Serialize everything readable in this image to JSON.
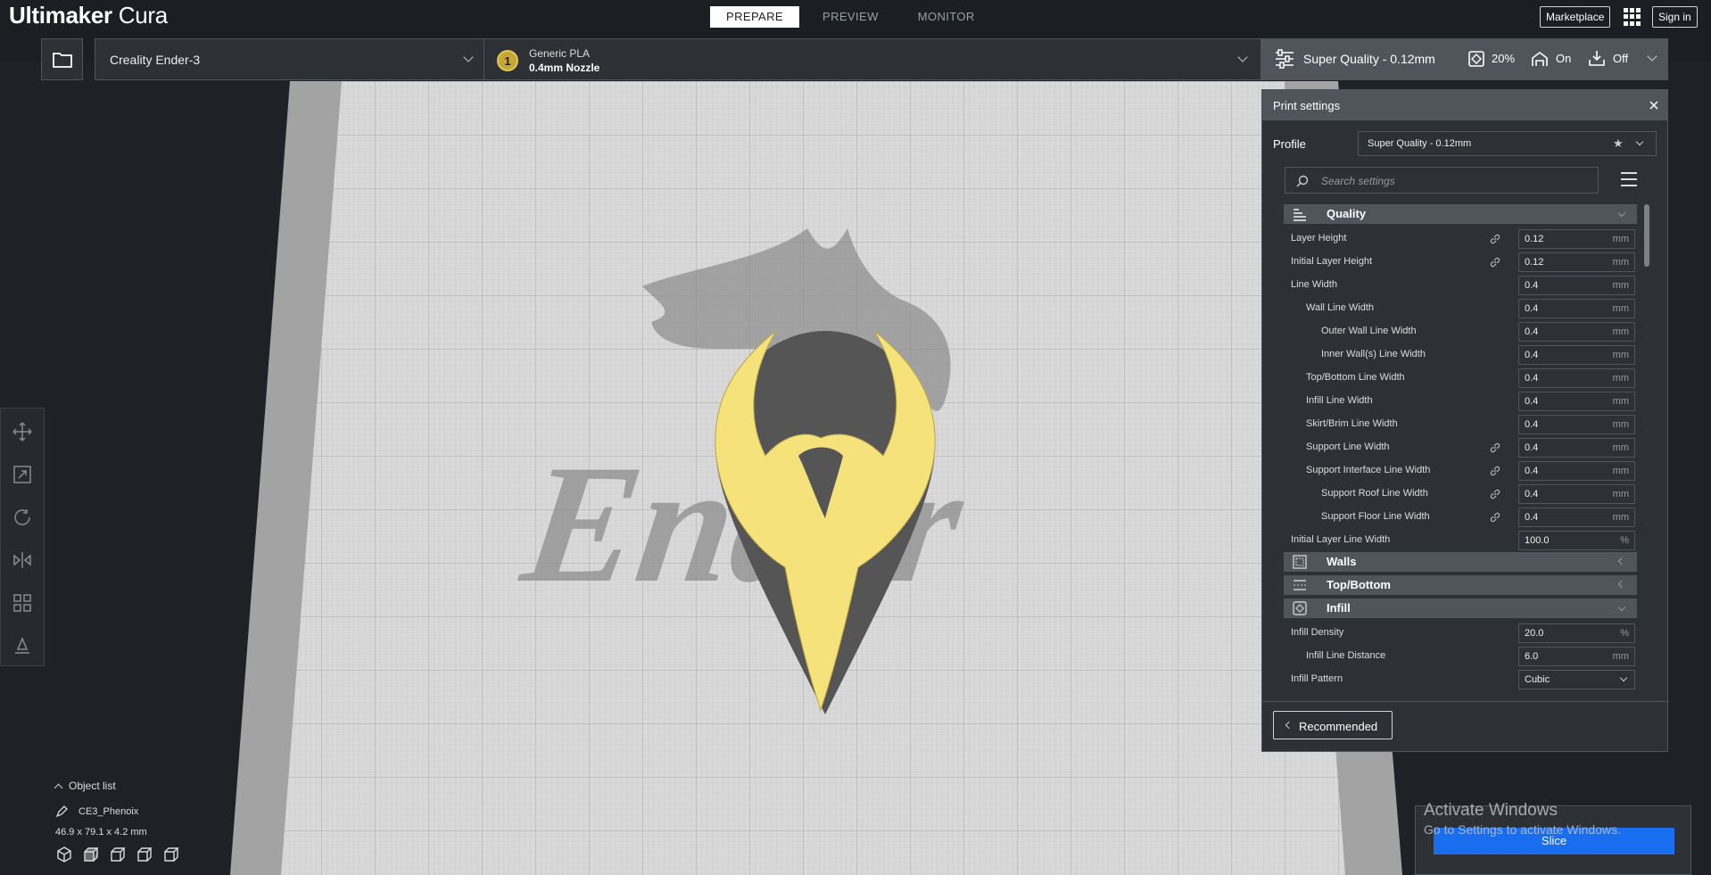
{
  "app": {
    "title_bold": "Ultimaker",
    "title_light": " Cura"
  },
  "stages": [
    "PREPARE",
    "PREVIEW",
    "MONITOR"
  ],
  "header_buttons": {
    "marketplace": "Marketplace",
    "sign_in": "Sign in"
  },
  "printer": {
    "name": "Creality Ender-3"
  },
  "material": {
    "extruder_number": "1",
    "name": "Generic PLA",
    "nozzle": "0.4mm Nozzle",
    "color": "#c7a536"
  },
  "quality_bar": {
    "profile": "Super Quality - 0.12mm",
    "infill": "20%",
    "support": "On",
    "adhesion": "Off"
  },
  "print_settings": {
    "title": "Print settings",
    "profile_label": "Profile",
    "profile_value": "Super Quality - 0.12mm",
    "search_placeholder": "Search settings"
  },
  "categories": {
    "quality": "Quality",
    "walls": "Walls",
    "topbottom": "Top/Bottom",
    "infill": "Infill"
  },
  "quality_settings": [
    {
      "label": "Layer Height",
      "value": "0.12",
      "unit": "mm"
    },
    {
      "label": "Initial Layer Height",
      "value": "0.12",
      "unit": "mm"
    },
    {
      "label": "Line Width",
      "value": "0.4",
      "unit": "mm"
    },
    {
      "label": "Wall Line Width",
      "value": "0.4",
      "unit": "mm"
    },
    {
      "label": "Outer Wall Line Width",
      "value": "0.4",
      "unit": "mm"
    },
    {
      "label": "Inner Wall(s) Line Width",
      "value": "0.4",
      "unit": "mm"
    },
    {
      "label": "Top/Bottom Line Width",
      "value": "0.4",
      "unit": "mm"
    },
    {
      "label": "Infill Line Width",
      "value": "0.4",
      "unit": "mm"
    },
    {
      "label": "Skirt/Brim Line Width",
      "value": "0.4",
      "unit": "mm"
    },
    {
      "label": "Support Line Width",
      "value": "0.4",
      "unit": "mm"
    },
    {
      "label": "Support Interface Line Width",
      "value": "0.4",
      "unit": "mm"
    },
    {
      "label": "Support Roof Line Width",
      "value": "0.4",
      "unit": "mm"
    },
    {
      "label": "Support Floor Line Width",
      "value": "0.4",
      "unit": "mm"
    },
    {
      "label": "Initial Layer Line Width",
      "value": "100.0",
      "unit": "%"
    }
  ],
  "infill_settings": [
    {
      "label": "Infill Density",
      "value": "20.0",
      "unit": "%"
    },
    {
      "label": "Infill Line Distance",
      "value": "6.0",
      "unit": "mm"
    },
    {
      "label": "Infill Pattern",
      "value": "Cubic",
      "unit": ""
    }
  ],
  "recommended_label": "Recommended",
  "object_list": {
    "header": "Object list",
    "object_name": "CE3_Phenoix",
    "dimensions": "46.9 x 79.1 x 4.2 mm"
  },
  "slice_label": "Slice",
  "watermark": {
    "line1": "Activate Windows",
    "line2": "Go to Settings to activate Windows."
  },
  "model_text": "Ender",
  "colors": {
    "accent": "#196ef0",
    "model": "#f5e27a",
    "panel": "#2d3136"
  }
}
